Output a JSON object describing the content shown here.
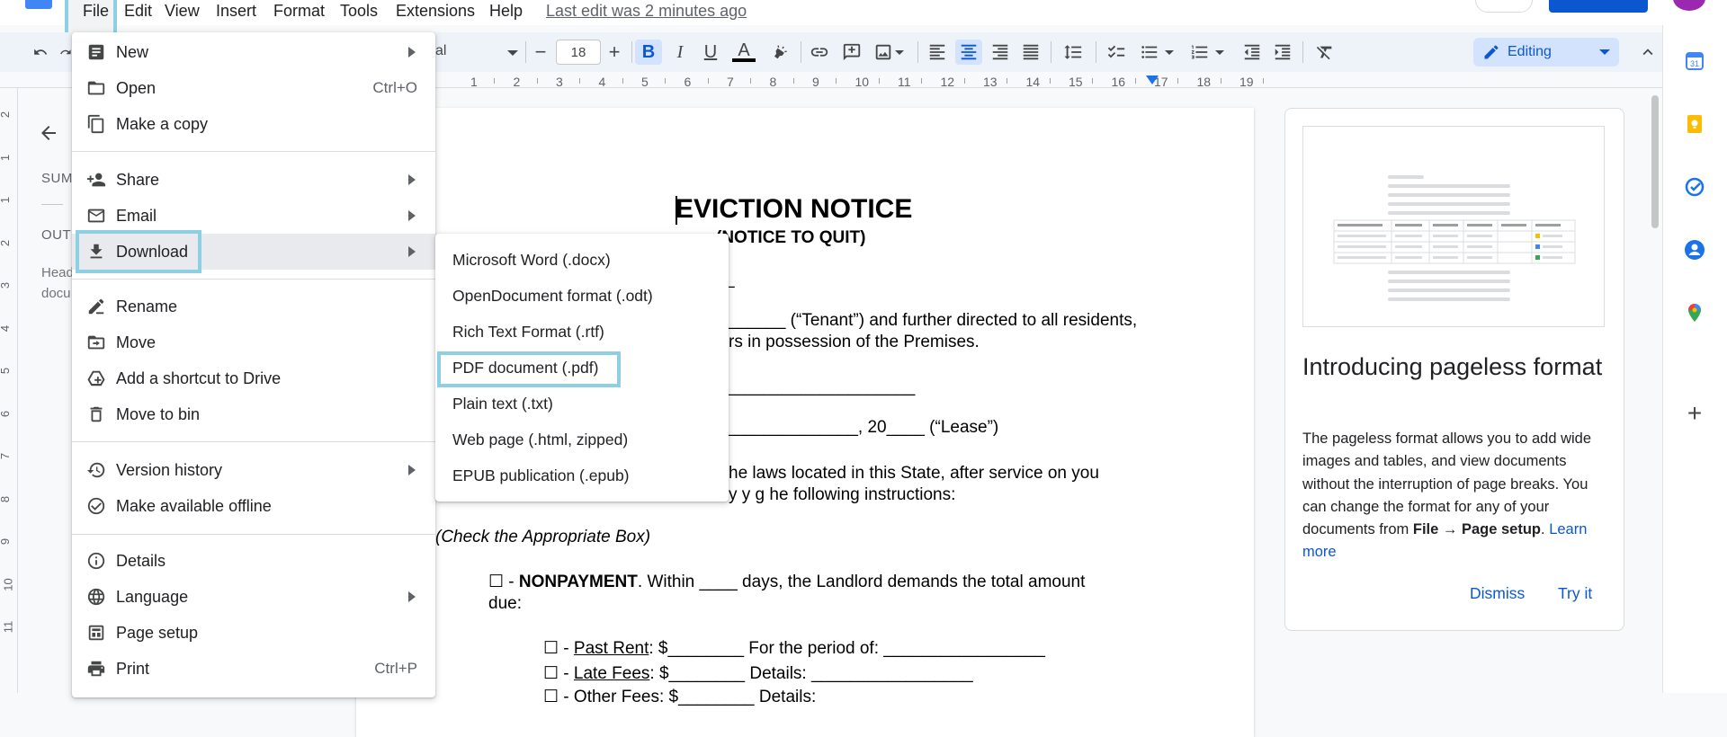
{
  "menubar": {
    "items": [
      "File",
      "Edit",
      "View",
      "Insert",
      "Format",
      "Tools",
      "Extensions",
      "Help"
    ],
    "last_edit": "Last edit was 2 minutes ago"
  },
  "toolbar": {
    "font_name_partial": "al",
    "font_size": "18",
    "bold_label": "B",
    "italic_label": "I",
    "underline_label": "U",
    "text_color_label": "A",
    "editing_mode": "Editing"
  },
  "ruler": {
    "numbers": [
      "1",
      "2",
      "3",
      "4",
      "5",
      "6",
      "7",
      "8",
      "9",
      "10",
      "11",
      "12",
      "13",
      "14",
      "15",
      "16",
      "17",
      "18",
      "19"
    ],
    "vertical_numbers": [
      "2",
      "1",
      "1",
      "2",
      "3",
      "4",
      "5",
      "6",
      "7",
      "8",
      "9",
      "10",
      "11"
    ]
  },
  "outline": {
    "summary_partial": "SUM",
    "outline_partial": "OUT",
    "hint_line1": "Head",
    "hint_line2": "docu"
  },
  "document": {
    "title": "EVICTION NOTICE",
    "subtitle": "(NOTICE TO QUIT)",
    "line_a": "_",
    "line_b": "______ (“Tenant”) and further directed to all residents,",
    "line_c": "rs in possession of the Premises.",
    "line_d": "____________________",
    "line_e": "______________, 20____ (“Lease”)",
    "line_f": "he laws located in this State, after service on you",
    "line_g": "y          y  g        he following instructions:",
    "line_h": "(Check the Appropriate Box)",
    "nonpayment_box": "☐ - ",
    "nonpayment_bold": "NONPAYMENT",
    "nonpayment_rest": ". Within ____ days, the Landlord demands the total amount",
    "nonpayment_due": "due:",
    "past_rent_box": "☐ - ",
    "past_rent_label": "Past Rent",
    "past_rent_rest": ": $________ For the period of: _________________",
    "late_fees_box": "☐ - ",
    "late_fees_label": "Late Fees",
    "late_fees_rest": ": $________ Details: _________________",
    "other_fees_partial": "☐ - Other Fees: $________ Details:"
  },
  "pageless_panel": {
    "title": "Introducing pageless format",
    "body_start": "The pageless format allows you to add wide images and tables, and view documents without the interruption of page breaks. You can change the format for any of your documents from ",
    "body_bold": "File → Page setup",
    "body_end": ". ",
    "learn_more": "Learn more",
    "dismiss": "Dismiss",
    "try_it": "Try it"
  },
  "file_menu": {
    "items": [
      {
        "label": "New",
        "shortcut": ""
      },
      {
        "label": "Open",
        "shortcut": "Ctrl+O"
      },
      {
        "label": "Make a copy",
        "shortcut": ""
      },
      {
        "label": "Share",
        "shortcut": ""
      },
      {
        "label": "Email",
        "shortcut": ""
      },
      {
        "label": "Download",
        "shortcut": ""
      },
      {
        "label": "Rename",
        "shortcut": ""
      },
      {
        "label": "Move",
        "shortcut": ""
      },
      {
        "label": "Add a shortcut to Drive",
        "shortcut": ""
      },
      {
        "label": "Move to bin",
        "shortcut": ""
      },
      {
        "label": "Version history",
        "shortcut": ""
      },
      {
        "label": "Make available offline",
        "shortcut": ""
      },
      {
        "label": "Details",
        "shortcut": ""
      },
      {
        "label": "Language",
        "shortcut": ""
      },
      {
        "label": "Page setup",
        "shortcut": ""
      },
      {
        "label": "Print",
        "shortcut": "Ctrl+P"
      }
    ]
  },
  "download_menu": {
    "items": [
      "Microsoft Word (.docx)",
      "OpenDocument format (.odt)",
      "Rich Text Format (.rtf)",
      "PDF document (.pdf)",
      "Plain text (.txt)",
      "Web page (.html, zipped)",
      "EPUB publication (.epub)"
    ]
  },
  "colors": {
    "accent": "#0b57d0",
    "highlight_box": "#8ecfe3",
    "editing_bg": "#d3e3fd"
  },
  "icons": {
    "side_panel": [
      "calendar-icon",
      "keep-icon",
      "tasks-icon",
      "contacts-icon",
      "maps-icon",
      "add-icon"
    ]
  }
}
